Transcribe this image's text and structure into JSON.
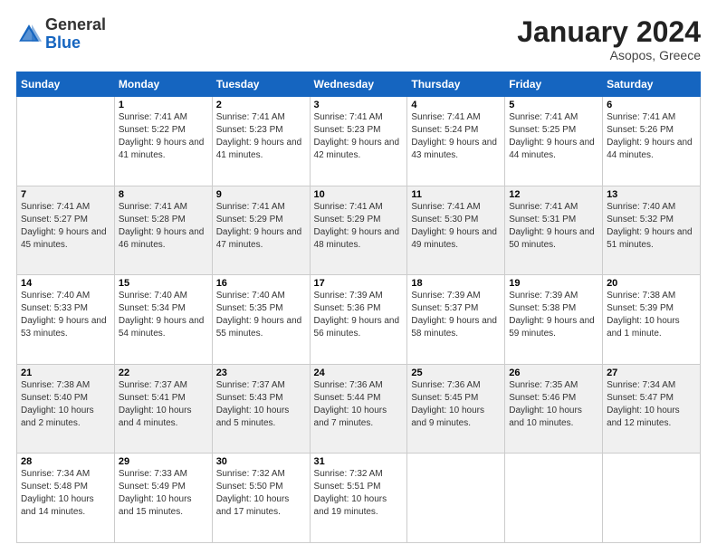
{
  "header": {
    "logo_line1": "General",
    "logo_line2": "Blue",
    "month_title": "January 2024",
    "location": "Asopos, Greece"
  },
  "weekdays": [
    "Sunday",
    "Monday",
    "Tuesday",
    "Wednesday",
    "Thursday",
    "Friday",
    "Saturday"
  ],
  "weeks": [
    [
      {
        "num": "",
        "sunrise": "",
        "sunset": "",
        "daylight": ""
      },
      {
        "num": "1",
        "sunrise": "Sunrise: 7:41 AM",
        "sunset": "Sunset: 5:22 PM",
        "daylight": "Daylight: 9 hours and 41 minutes."
      },
      {
        "num": "2",
        "sunrise": "Sunrise: 7:41 AM",
        "sunset": "Sunset: 5:23 PM",
        "daylight": "Daylight: 9 hours and 41 minutes."
      },
      {
        "num": "3",
        "sunrise": "Sunrise: 7:41 AM",
        "sunset": "Sunset: 5:23 PM",
        "daylight": "Daylight: 9 hours and 42 minutes."
      },
      {
        "num": "4",
        "sunrise": "Sunrise: 7:41 AM",
        "sunset": "Sunset: 5:24 PM",
        "daylight": "Daylight: 9 hours and 43 minutes."
      },
      {
        "num": "5",
        "sunrise": "Sunrise: 7:41 AM",
        "sunset": "Sunset: 5:25 PM",
        "daylight": "Daylight: 9 hours and 44 minutes."
      },
      {
        "num": "6",
        "sunrise": "Sunrise: 7:41 AM",
        "sunset": "Sunset: 5:26 PM",
        "daylight": "Daylight: 9 hours and 44 minutes."
      }
    ],
    [
      {
        "num": "7",
        "sunrise": "Sunrise: 7:41 AM",
        "sunset": "Sunset: 5:27 PM",
        "daylight": "Daylight: 9 hours and 45 minutes."
      },
      {
        "num": "8",
        "sunrise": "Sunrise: 7:41 AM",
        "sunset": "Sunset: 5:28 PM",
        "daylight": "Daylight: 9 hours and 46 minutes."
      },
      {
        "num": "9",
        "sunrise": "Sunrise: 7:41 AM",
        "sunset": "Sunset: 5:29 PM",
        "daylight": "Daylight: 9 hours and 47 minutes."
      },
      {
        "num": "10",
        "sunrise": "Sunrise: 7:41 AM",
        "sunset": "Sunset: 5:29 PM",
        "daylight": "Daylight: 9 hours and 48 minutes."
      },
      {
        "num": "11",
        "sunrise": "Sunrise: 7:41 AM",
        "sunset": "Sunset: 5:30 PM",
        "daylight": "Daylight: 9 hours and 49 minutes."
      },
      {
        "num": "12",
        "sunrise": "Sunrise: 7:41 AM",
        "sunset": "Sunset: 5:31 PM",
        "daylight": "Daylight: 9 hours and 50 minutes."
      },
      {
        "num": "13",
        "sunrise": "Sunrise: 7:40 AM",
        "sunset": "Sunset: 5:32 PM",
        "daylight": "Daylight: 9 hours and 51 minutes."
      }
    ],
    [
      {
        "num": "14",
        "sunrise": "Sunrise: 7:40 AM",
        "sunset": "Sunset: 5:33 PM",
        "daylight": "Daylight: 9 hours and 53 minutes."
      },
      {
        "num": "15",
        "sunrise": "Sunrise: 7:40 AM",
        "sunset": "Sunset: 5:34 PM",
        "daylight": "Daylight: 9 hours and 54 minutes."
      },
      {
        "num": "16",
        "sunrise": "Sunrise: 7:40 AM",
        "sunset": "Sunset: 5:35 PM",
        "daylight": "Daylight: 9 hours and 55 minutes."
      },
      {
        "num": "17",
        "sunrise": "Sunrise: 7:39 AM",
        "sunset": "Sunset: 5:36 PM",
        "daylight": "Daylight: 9 hours and 56 minutes."
      },
      {
        "num": "18",
        "sunrise": "Sunrise: 7:39 AM",
        "sunset": "Sunset: 5:37 PM",
        "daylight": "Daylight: 9 hours and 58 minutes."
      },
      {
        "num": "19",
        "sunrise": "Sunrise: 7:39 AM",
        "sunset": "Sunset: 5:38 PM",
        "daylight": "Daylight: 9 hours and 59 minutes."
      },
      {
        "num": "20",
        "sunrise": "Sunrise: 7:38 AM",
        "sunset": "Sunset: 5:39 PM",
        "daylight": "Daylight: 10 hours and 1 minute."
      }
    ],
    [
      {
        "num": "21",
        "sunrise": "Sunrise: 7:38 AM",
        "sunset": "Sunset: 5:40 PM",
        "daylight": "Daylight: 10 hours and 2 minutes."
      },
      {
        "num": "22",
        "sunrise": "Sunrise: 7:37 AM",
        "sunset": "Sunset: 5:41 PM",
        "daylight": "Daylight: 10 hours and 4 minutes."
      },
      {
        "num": "23",
        "sunrise": "Sunrise: 7:37 AM",
        "sunset": "Sunset: 5:43 PM",
        "daylight": "Daylight: 10 hours and 5 minutes."
      },
      {
        "num": "24",
        "sunrise": "Sunrise: 7:36 AM",
        "sunset": "Sunset: 5:44 PM",
        "daylight": "Daylight: 10 hours and 7 minutes."
      },
      {
        "num": "25",
        "sunrise": "Sunrise: 7:36 AM",
        "sunset": "Sunset: 5:45 PM",
        "daylight": "Daylight: 10 hours and 9 minutes."
      },
      {
        "num": "26",
        "sunrise": "Sunrise: 7:35 AM",
        "sunset": "Sunset: 5:46 PM",
        "daylight": "Daylight: 10 hours and 10 minutes."
      },
      {
        "num": "27",
        "sunrise": "Sunrise: 7:34 AM",
        "sunset": "Sunset: 5:47 PM",
        "daylight": "Daylight: 10 hours and 12 minutes."
      }
    ],
    [
      {
        "num": "28",
        "sunrise": "Sunrise: 7:34 AM",
        "sunset": "Sunset: 5:48 PM",
        "daylight": "Daylight: 10 hours and 14 minutes."
      },
      {
        "num": "29",
        "sunrise": "Sunrise: 7:33 AM",
        "sunset": "Sunset: 5:49 PM",
        "daylight": "Daylight: 10 hours and 15 minutes."
      },
      {
        "num": "30",
        "sunrise": "Sunrise: 7:32 AM",
        "sunset": "Sunset: 5:50 PM",
        "daylight": "Daylight: 10 hours and 17 minutes."
      },
      {
        "num": "31",
        "sunrise": "Sunrise: 7:32 AM",
        "sunset": "Sunset: 5:51 PM",
        "daylight": "Daylight: 10 hours and 19 minutes."
      },
      {
        "num": "",
        "sunrise": "",
        "sunset": "",
        "daylight": ""
      },
      {
        "num": "",
        "sunrise": "",
        "sunset": "",
        "daylight": ""
      },
      {
        "num": "",
        "sunrise": "",
        "sunset": "",
        "daylight": ""
      }
    ]
  ]
}
